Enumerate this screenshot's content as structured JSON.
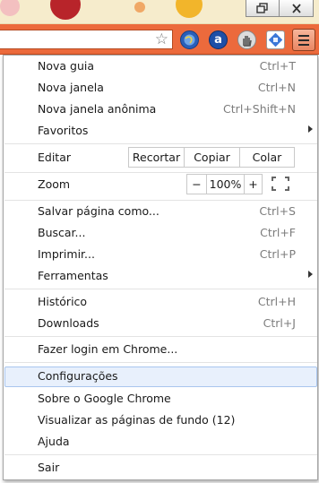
{
  "window": {
    "restore_icon": "restore-icon",
    "close_icon": "close-icon"
  },
  "toolbar": {
    "bookmark_icon": "star-icon",
    "extensions": [
      "globe-icon",
      "amazon-icon",
      "hand-icon",
      "puzzle-icon"
    ],
    "menu_icon": "hamburger-menu-icon",
    "accent": "#ec6a3c"
  },
  "menu": {
    "new_tab": {
      "label": "Nova guia",
      "shortcut": "Ctrl+T"
    },
    "new_window": {
      "label": "Nova janela",
      "shortcut": "Ctrl+N"
    },
    "incognito": {
      "label": "Nova janela anônima",
      "shortcut": "Ctrl+Shift+N"
    },
    "bookmarks": {
      "label": "Favoritos"
    },
    "edit": {
      "label": "Editar",
      "cut": "Recortar",
      "copy": "Copiar",
      "paste": "Colar"
    },
    "zoom": {
      "label": "Zoom",
      "minus": "−",
      "value": "100%",
      "plus": "+"
    },
    "save_page": {
      "label": "Salvar página como...",
      "shortcut": "Ctrl+S"
    },
    "find": {
      "label": "Buscar...",
      "shortcut": "Ctrl+F"
    },
    "print": {
      "label": "Imprimir...",
      "shortcut": "Ctrl+P"
    },
    "tools": {
      "label": "Ferramentas"
    },
    "history": {
      "label": "Histórico",
      "shortcut": "Ctrl+H"
    },
    "downloads": {
      "label": "Downloads",
      "shortcut": "Ctrl+J"
    },
    "sign_in": {
      "label": "Fazer login em Chrome..."
    },
    "settings": {
      "label": "Configurações"
    },
    "about": {
      "label": "Sobre o Google Chrome"
    },
    "background_pages": {
      "label": "Visualizar as páginas de fundo (12)"
    },
    "help": {
      "label": "Ajuda"
    },
    "exit": {
      "label": "Sair"
    }
  }
}
